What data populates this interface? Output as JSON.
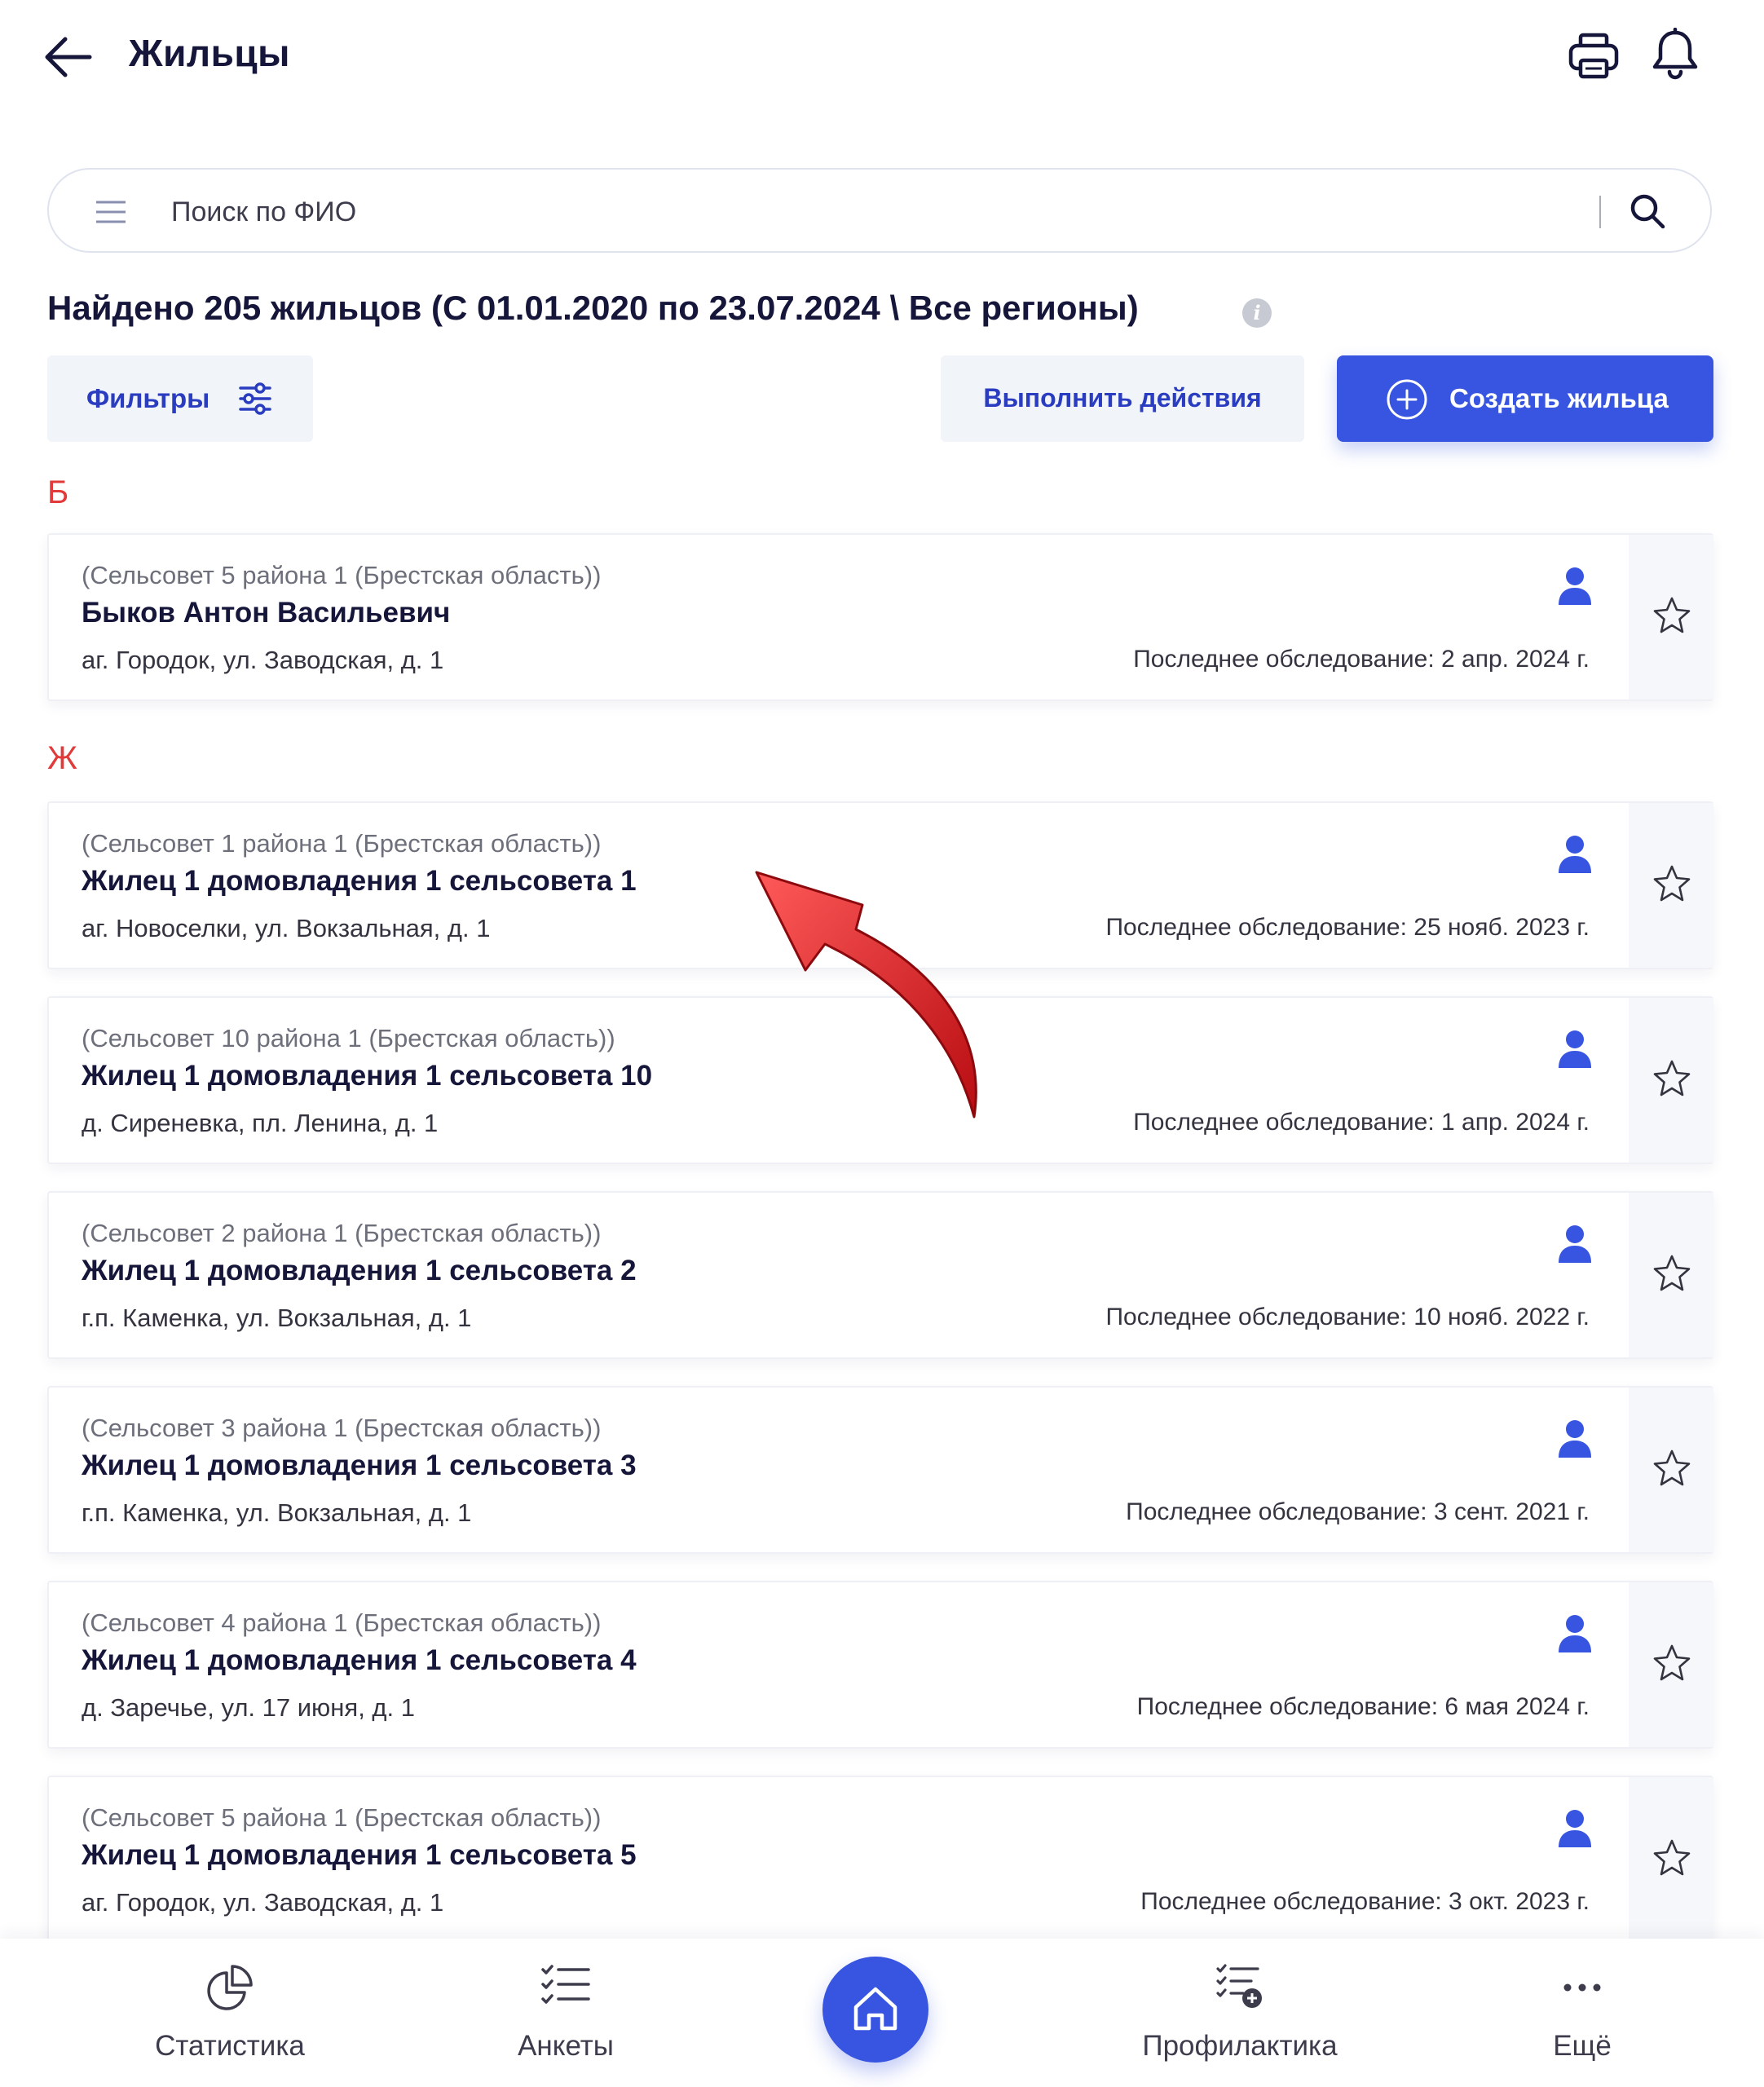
{
  "header": {
    "title": "Жильцы",
    "back_icon": "arrow-left-icon",
    "print_icon": "printer-icon",
    "notifications_icon": "bell-icon"
  },
  "search": {
    "value": "",
    "placeholder": "Поиск по ФИО",
    "menu_icon": "menu-icon",
    "search_icon": "search-icon"
  },
  "summary": {
    "found_text": "Найдено 205 жильцов (С 01.01.2020 по 23.07.2024 \\ Все регионы)"
  },
  "toolbar": {
    "filters_label": "Фильтры",
    "actions_label": "Выполнить действия",
    "create_label": "Создать жильца"
  },
  "colors": {
    "accent": "#3755e0",
    "accent_text": "#2a3cc0",
    "section_letter": "#e03a3a",
    "annotation_arrow": "#d9161c"
  },
  "sections": [
    {
      "letter": "Б",
      "residents": [
        {
          "region": "(Сельсовет 5 района 1 (Брестская область))",
          "name": "Быков Антон Васильевич",
          "address": "аг. Городок, ул. Заводская, д. 1",
          "last_survey": "Последнее обследование: 2 апр. 2024 г."
        }
      ]
    },
    {
      "letter": "Ж",
      "residents": [
        {
          "region": "(Сельсовет 1 района 1 (Брестская область))",
          "name": "Жилец 1 домовладения 1 сельсовета 1",
          "address": "аг. Новоселки, ул. Вокзальная, д. 1",
          "last_survey": "Последнее обследование: 25 нояб. 2023 г."
        },
        {
          "region": "(Сельсовет 10 района 1 (Брестская область))",
          "name": "Жилец 1 домовладения 1 сельсовета 10",
          "address": "д. Сиреневка, пл. Ленина, д. 1",
          "last_survey": "Последнее обследование: 1 апр. 2024 г."
        },
        {
          "region": "(Сельсовет 2 района 1 (Брестская область))",
          "name": "Жилец 1 домовладения 1 сельсовета 2",
          "address": "г.п. Каменка, ул. Вокзальная, д. 1",
          "last_survey": "Последнее обследование: 10 нояб. 2022 г."
        },
        {
          "region": "(Сельсовет 3 района 1 (Брестская область))",
          "name": "Жилец 1 домовладения 1 сельсовета 3",
          "address": "г.п. Каменка, ул. Вокзальная, д. 1",
          "last_survey": "Последнее обследование: 3 сент. 2021 г."
        },
        {
          "region": "(Сельсовет 4 района 1 (Брестская область))",
          "name": "Жилец 1 домовладения 1 сельсовета 4",
          "address": "д. Заречье, ул. 17 июня, д. 1",
          "last_survey": "Последнее обследование: 6 мая 2024 г."
        },
        {
          "region": "(Сельсовет 5 района 1 (Брестская область))",
          "name": "Жилец 1 домовладения 1 сельсовета 5",
          "address": "аг. Городок, ул. Заводская, д. 1",
          "last_survey": "Последнее обследование: 3 окт. 2023 г."
        }
      ]
    }
  ],
  "bottom_nav": {
    "items": [
      {
        "label": "Статистика",
        "icon": "pie-chart-icon"
      },
      {
        "label": "Анкеты",
        "icon": "checklist-icon"
      },
      {
        "label": "",
        "icon": "home-icon"
      },
      {
        "label": "Профилактика",
        "icon": "checklist-add-icon"
      },
      {
        "label": "Ещё",
        "icon": "more-dots-icon"
      }
    ]
  }
}
